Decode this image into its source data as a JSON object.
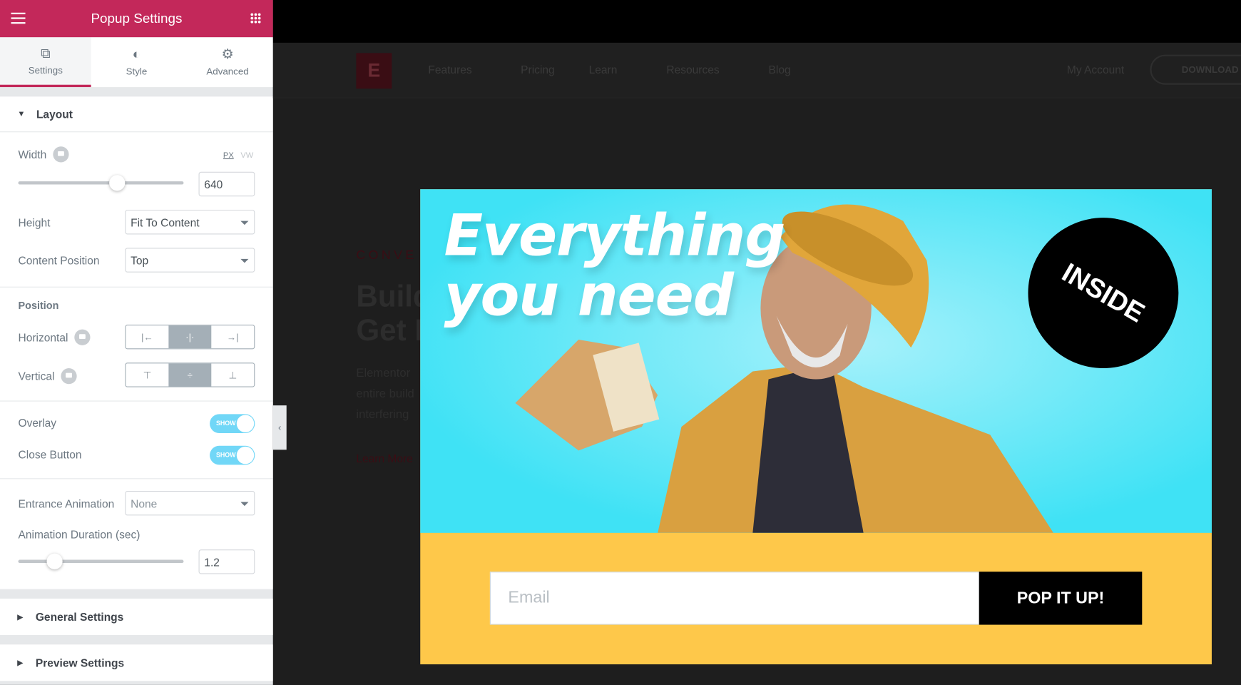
{
  "panel": {
    "title": "Popup Settings",
    "tabs": [
      {
        "label": "Settings",
        "icon": "settings-icon"
      },
      {
        "label": "Style",
        "icon": "half-circle-icon"
      },
      {
        "label": "Advanced",
        "icon": "gear-icon"
      }
    ],
    "layout": {
      "title": "Layout",
      "width": {
        "label": "Width",
        "units": [
          "PX",
          "VW"
        ],
        "active_unit": "PX",
        "value": "640",
        "slider_percent": 60
      },
      "height": {
        "label": "Height",
        "value": "Fit To Content"
      },
      "content_position": {
        "label": "Content Position",
        "value": "Top"
      },
      "position_title": "Position",
      "horizontal": {
        "label": "Horizontal",
        "options": [
          "left",
          "center",
          "right"
        ],
        "selected": "center"
      },
      "vertical": {
        "label": "Vertical",
        "options": [
          "top",
          "middle",
          "bottom"
        ],
        "selected": "middle"
      },
      "overlay": {
        "label": "Overlay",
        "toggle": "SHOW"
      },
      "close_button": {
        "label": "Close Button",
        "toggle": "SHOW"
      },
      "entrance_animation": {
        "label": "Entrance Animation",
        "value": "None"
      },
      "animation_duration": {
        "label": "Animation Duration (sec)",
        "value": "1.2",
        "slider_percent": 22
      }
    },
    "general_settings": "General Settings",
    "preview_settings": "Preview Settings"
  },
  "site": {
    "nav": [
      "Features",
      "Pricing",
      "Learn",
      "Resources",
      "Blog"
    ],
    "account": "My Account",
    "download": "DOWNLOAD",
    "eyebrow": "CONVE",
    "heading": [
      "Build",
      "Get M"
    ],
    "body": [
      "Elementor",
      "entire build",
      "interfering"
    ],
    "learn_more": "Learn More"
  },
  "popup": {
    "headline": [
      "Everything",
      "you need"
    ],
    "badge": "INSIDE",
    "email_placeholder": "Email",
    "button": "POP IT UP!",
    "colors": {
      "bg": "#fec84a",
      "hero": "#3fe2f5",
      "button": "#000000"
    }
  }
}
